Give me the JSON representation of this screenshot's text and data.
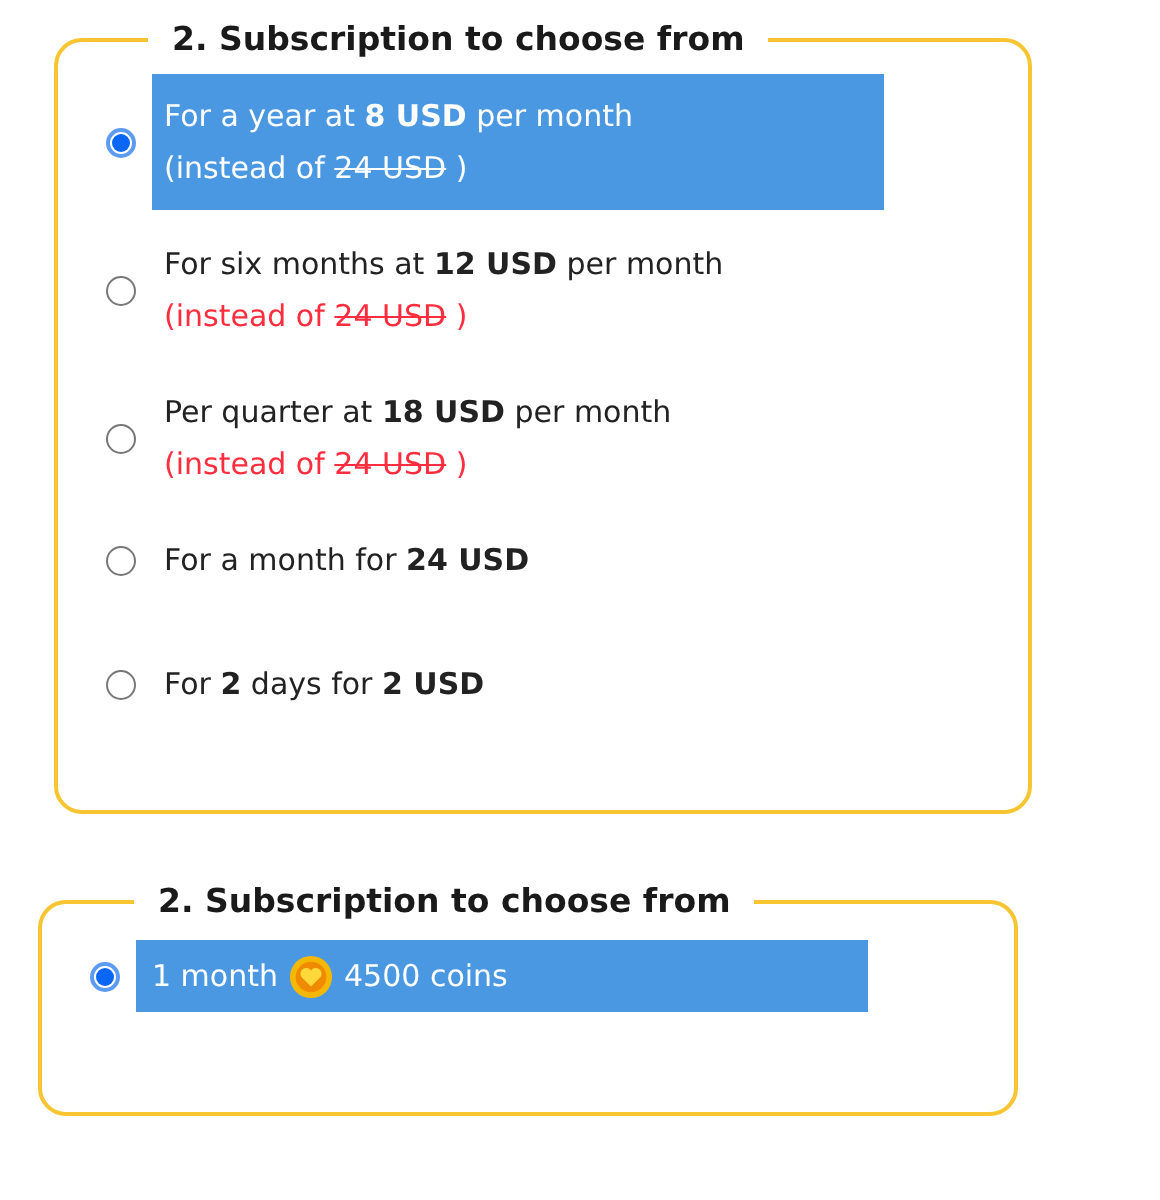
{
  "groups": [
    {
      "legend": "2. Subscription to choose from",
      "options": [
        {
          "kind": "price",
          "selected": true,
          "text": "For a year at **8 USD** per month",
          "note_prefix": "(instead of",
          "old_price": "24 USD",
          "note_suffix": ")"
        },
        {
          "kind": "price",
          "selected": false,
          "text": "For six months at **12 USD** per month",
          "note_prefix": "(instead of",
          "old_price": "24 USD",
          "note_suffix": ")"
        },
        {
          "kind": "price",
          "selected": false,
          "text": "Per quarter at **18 USD** per month",
          "note_prefix": "(instead of",
          "old_price": "24 USD",
          "note_suffix": ")"
        },
        {
          "kind": "price",
          "selected": false,
          "text": "For a month for **24 USD**"
        },
        {
          "kind": "price",
          "selected": false,
          "text": "For **2** days for **2 USD**"
        }
      ]
    },
    {
      "legend": "2. Subscription to choose from",
      "options": [
        {
          "kind": "coins",
          "selected": true,
          "period": "1 month",
          "amount": "4500 coins"
        }
      ]
    }
  ]
}
